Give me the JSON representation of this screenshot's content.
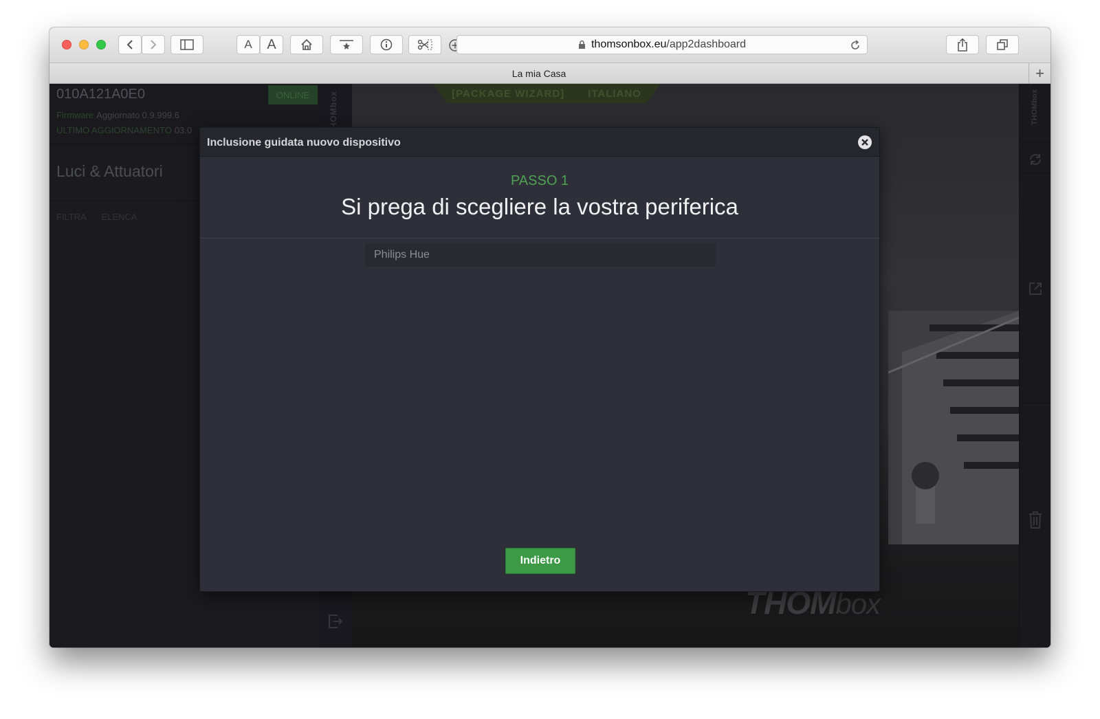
{
  "browser": {
    "url_domain": "thomsonbox.eu",
    "url_path": "/app2dashboard",
    "tab_title": "La mia Casa",
    "new_tab_label": "+",
    "font_small_label": "A",
    "font_large_label": "A"
  },
  "sidebar": {
    "device_id": "010A121A0E0",
    "status_badge": "ONLINE",
    "firmware_label": "Firmware",
    "firmware_value": "Aggiornato 0.9.999.6",
    "last_update_label": "ULTIMO AGGIORNAMENTO",
    "last_update_value": "03.0",
    "section_title": "Luci & Attuatori",
    "filter_label": "FILTRA",
    "list_label": "ELENCA"
  },
  "header": {
    "package_wizard": "[PACKAGE WIZARD]",
    "language": "ITALIANO"
  },
  "brand": {
    "name_bold": "THOM",
    "name_light": "box"
  },
  "modal": {
    "title": "Inclusione guidata nuovo dispositivo",
    "step": "PASSO 1",
    "heading": "Si prega di scegliere la vostra periferica",
    "devices": [
      {
        "label": "Philips Hue"
      }
    ],
    "back_button": "Indietro"
  },
  "colors": {
    "accent_green": "#3d9945",
    "step_green": "#4ea353",
    "modal_bg": "#2f2f39"
  },
  "icons": [
    "back-icon",
    "forward-icon",
    "sidebar-icon",
    "home-icon",
    "bookmark-icon",
    "info-icon",
    "scissors-icon",
    "add-icon",
    "lock-icon",
    "reload-icon",
    "share-icon",
    "tabs-icon",
    "close-icon",
    "refresh-icon",
    "external-link-icon",
    "trash-icon",
    "exit-icon"
  ]
}
